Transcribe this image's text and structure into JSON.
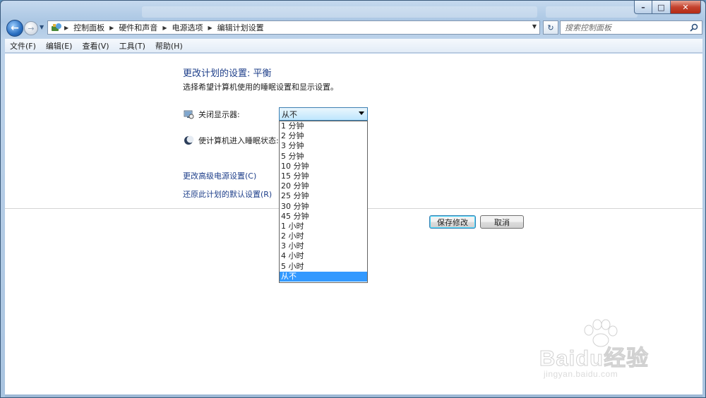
{
  "window": {
    "caption": {
      "min": "–",
      "max": "□",
      "close": "✕"
    }
  },
  "nav": {
    "back": "←",
    "forward": "→",
    "breadcrumb": [
      "控制面板",
      "硬件和声音",
      "电源选项",
      "编辑计划设置"
    ],
    "refresh": "↻",
    "search_placeholder": "搜索控制面板"
  },
  "menu": [
    "文件(F)",
    "编辑(E)",
    "查看(V)",
    "工具(T)",
    "帮助(H)"
  ],
  "main": {
    "title": "更改计划的设置: 平衡",
    "description": "选择希望计算机使用的睡眠设置和显示设置。",
    "display_off": {
      "label": "关闭显示器:",
      "value": "从不",
      "options": [
        "1 分钟",
        "2 分钟",
        "3 分钟",
        "5 分钟",
        "10 分钟",
        "15 分钟",
        "20 分钟",
        "25 分钟",
        "30 分钟",
        "45 分钟",
        "1 小时",
        "2 小时",
        "3 小时",
        "4 小时",
        "5 小时",
        "从不"
      ],
      "selected_index": 15
    },
    "sleep": {
      "label": "使计算机进入睡眠状态:"
    },
    "advanced_link": "更改高级电源设置(C)",
    "restore_link": "还原此计划的默认设置(R)",
    "save_button": "保存修改",
    "cancel_button": "取消"
  },
  "watermark": {
    "brand": "Baidu经验",
    "url": "jingyan.baidu.com"
  },
  "colors": {
    "link": "#1e3f8a",
    "selection": "#3399ff",
    "window_frame": "#aac6e3"
  }
}
